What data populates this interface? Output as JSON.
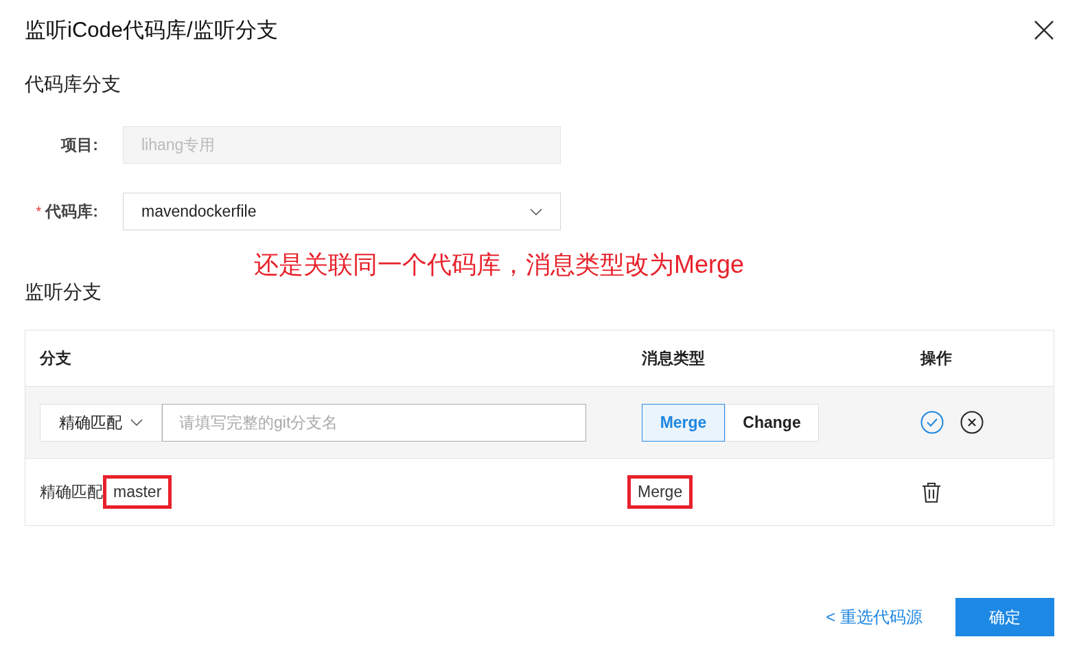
{
  "dialog": {
    "title": "监听iCode代码库/监听分支"
  },
  "repo_section": {
    "heading": "代码库分支",
    "fields": [
      {
        "kind": "text",
        "label": "项目:",
        "disabled": true,
        "value": "lihang专用"
      },
      {
        "kind": "select",
        "label": "代码库:",
        "required_mark": "*",
        "disabled": false,
        "value": "mavendockerfile"
      }
    ]
  },
  "annotation": "还是关联同一个代码库，消息类型改为Merge",
  "branch_section": {
    "heading": "监听分支",
    "table": {
      "columns": [
        "分支",
        "消息类型",
        "操作"
      ],
      "edit_row": {
        "match_type": "精确匹配",
        "branch_placeholder": "请填写完整的git分支名",
        "message_types": [
          {
            "label": "Merge",
            "selected": true
          },
          {
            "label": "Change",
            "selected": false
          }
        ]
      },
      "rows": [
        {
          "match_type": "精确匹配",
          "branch": "master",
          "branch_highlighted": true,
          "message_type": "Merge",
          "message_highlighted": true
        }
      ]
    }
  },
  "footer": {
    "back_link": "< 重选代码源",
    "confirm_button": "确定"
  }
}
